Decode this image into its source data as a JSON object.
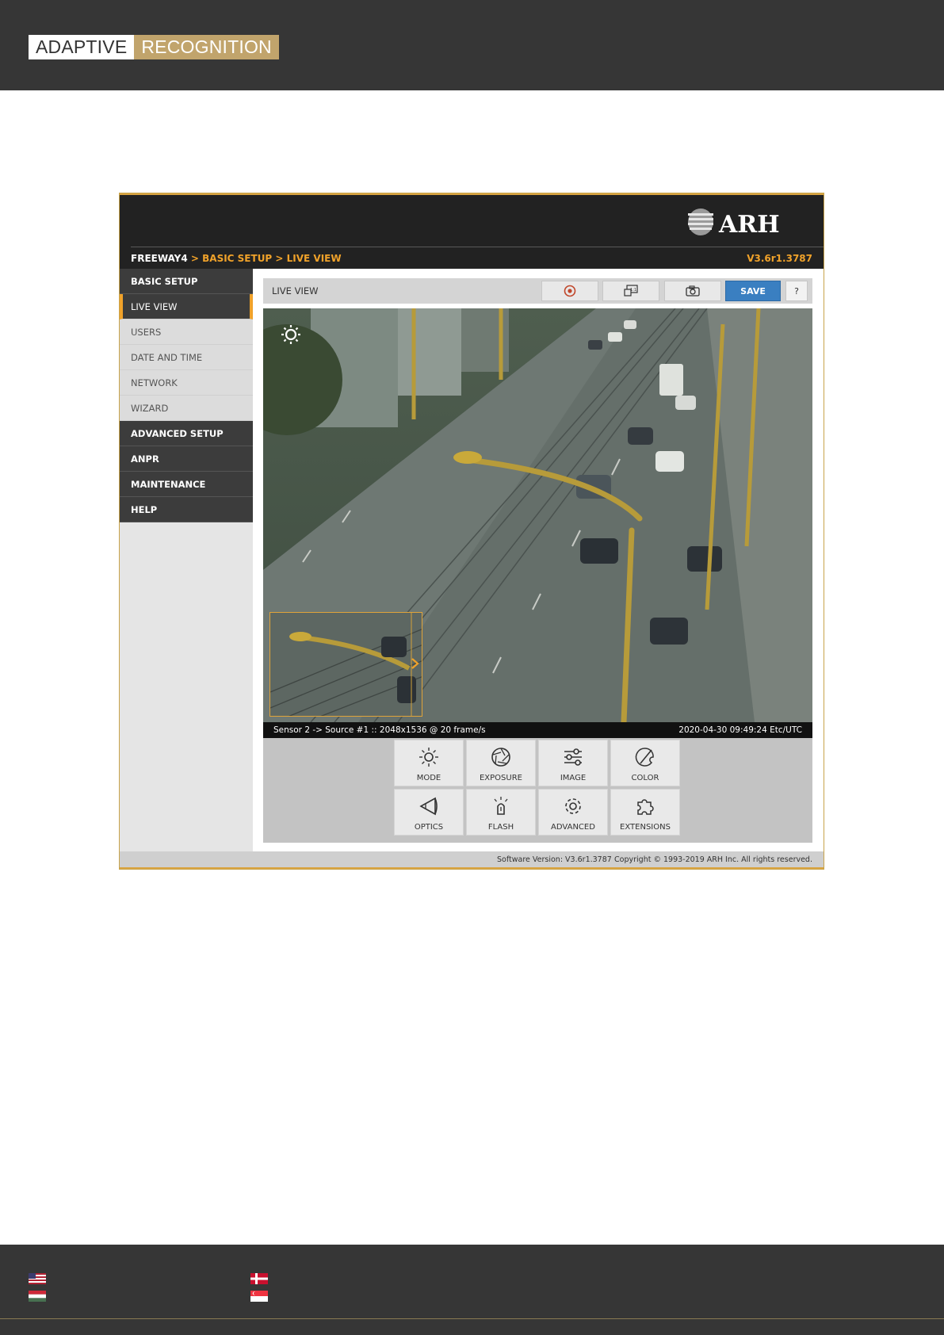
{
  "brand": {
    "word1": "ADAPTIVE",
    "word2": "RECOGNITION",
    "accent": "#c1a46c"
  },
  "app": {
    "logo_text": "ARH",
    "breadcrumb": {
      "root": "FREEWAY4",
      "sep1": " > ",
      "level1": "BASIC SETUP",
      "sep2": " > ",
      "level2": "LIVE VIEW"
    },
    "version": "V3.6r1.3787",
    "accent": "#f0a22a"
  },
  "sidebar": {
    "items": [
      {
        "label": "BASIC SETUP",
        "kind": "head"
      },
      {
        "label": "LIVE VIEW",
        "kind": "active"
      },
      {
        "label": "USERS",
        "kind": "sub"
      },
      {
        "label": "DATE AND TIME",
        "kind": "sub"
      },
      {
        "label": "NETWORK",
        "kind": "sub"
      },
      {
        "label": "WIZARD",
        "kind": "sub"
      },
      {
        "label": "ADVANCED SETUP",
        "kind": "head"
      },
      {
        "label": "ANPR",
        "kind": "head"
      },
      {
        "label": "MAINTENANCE",
        "kind": "head"
      },
      {
        "label": "HELP",
        "kind": "head"
      }
    ]
  },
  "toolbar": {
    "title": "LIVE VIEW",
    "record_icon": "record-icon",
    "resolution_icon": "resolution-icon",
    "snapshot_icon": "camera-icon",
    "save_label": "SAVE",
    "help_label": "?",
    "save_color": "#3a7fc1"
  },
  "video": {
    "status_left": "Sensor 2 -> Source #1 :: 2048x1536 @ 20 frame/s",
    "status_right": "2020-04-30 09:49:24 Etc/UTC",
    "overlay_icon": "brightness-icon",
    "zoom_arrow_icon": "chevron-right-icon"
  },
  "controls": [
    {
      "label": "MODE",
      "icon": "sun-icon"
    },
    {
      "label": "EXPOSURE",
      "icon": "aperture-icon"
    },
    {
      "label": "IMAGE",
      "icon": "sliders-icon"
    },
    {
      "label": "COLOR",
      "icon": "palette-icon"
    },
    {
      "label": "OPTICS",
      "icon": "lens-icon"
    },
    {
      "label": "FLASH",
      "icon": "flash-bulb-icon"
    },
    {
      "label": "ADVANCED",
      "icon": "gear-icon"
    },
    {
      "label": "EXTENSIONS",
      "icon": "puzzle-icon"
    }
  ],
  "footer": {
    "software_version": "Software Version:   V3.6r1.3787",
    "copyright": "Copyright © 1993-2019 ARH Inc. All rights reserved."
  },
  "page_footer": {
    "flags": [
      "us-flag-icon",
      "denmark-flag-icon",
      "hungary-flag-icon",
      "singapore-flag-icon"
    ]
  }
}
